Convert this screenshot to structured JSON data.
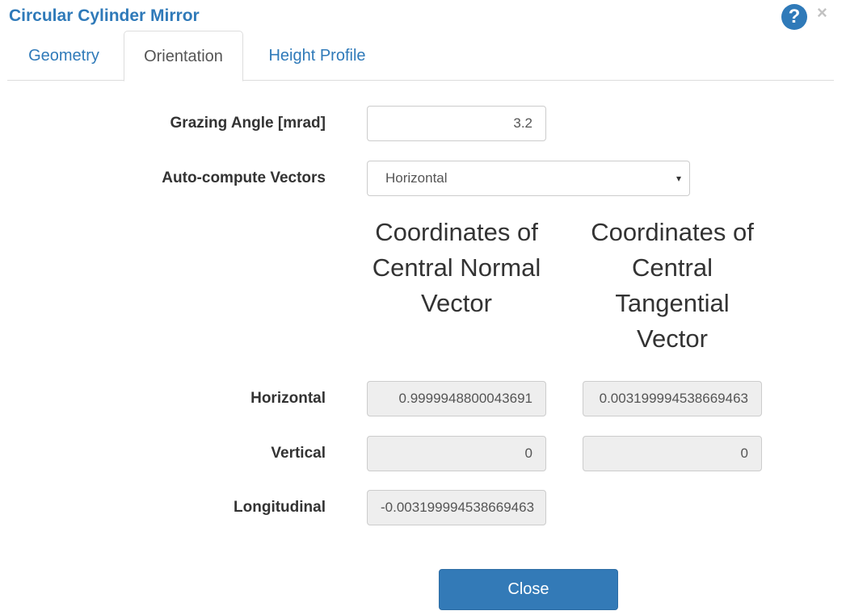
{
  "dialog": {
    "title": "Circular Cylinder Mirror",
    "help_glyph": "?",
    "close_glyph": "×"
  },
  "tabs": [
    {
      "label": "Geometry",
      "active": false
    },
    {
      "label": "Orientation",
      "active": true
    },
    {
      "label": "Height Profile",
      "active": false
    }
  ],
  "form": {
    "grazing_angle": {
      "label": "Grazing Angle [mrad]",
      "value": "3.2"
    },
    "auto_compute": {
      "label": "Auto-compute Vectors",
      "selected": "Horizontal",
      "caret": "▾"
    }
  },
  "columns": {
    "normal_heading": "Coordinates of Central Normal Vector",
    "tangential_heading": "Coordinates of Central Tangential Vector"
  },
  "rows": {
    "horizontal": {
      "label": "Horizontal",
      "normal": "0.9999948800043691",
      "tangential": "0.003199994538669463"
    },
    "vertical": {
      "label": "Vertical",
      "normal": "0",
      "tangential": "0"
    },
    "longitudinal": {
      "label": "Longitudinal",
      "normal": "-0.003199994538669463"
    }
  },
  "footer": {
    "close_label": "Close"
  },
  "colors": {
    "accent": "#2f7ab9",
    "primary_button": "#337ab7",
    "readonly_bg": "#eeeeee"
  }
}
